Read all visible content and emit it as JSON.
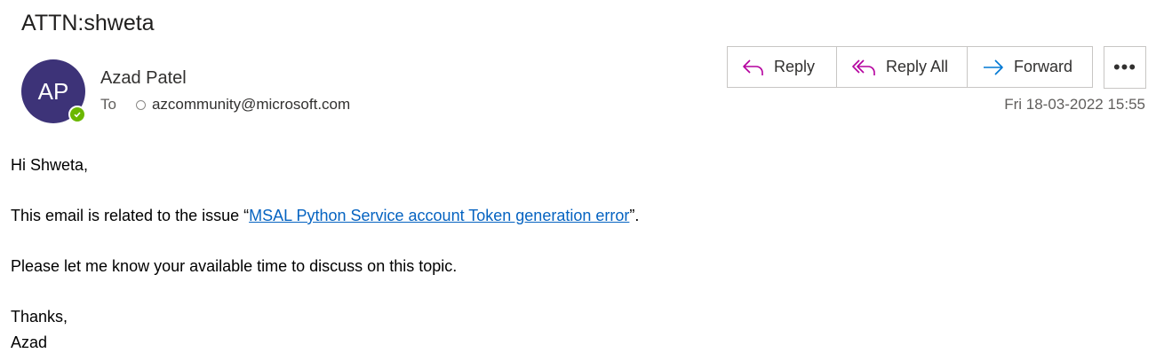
{
  "subject": "ATTN:shweta",
  "sender": {
    "initials": "AP",
    "name": "Azad Patel",
    "to_label": "To",
    "to_address": "azcommunity@microsoft.com",
    "presence_color": "#6bb700",
    "avatar_color": "#3d3378"
  },
  "actions": {
    "reply": "Reply",
    "reply_all": "Reply All",
    "forward": "Forward",
    "more": "•••"
  },
  "date": "Fri 18-03-2022 15:55",
  "body": {
    "greeting": "Hi Shweta,",
    "line1_prefix": "This email is related to the issue “",
    "line1_link": "MSAL Python Service account Token generation error",
    "line1_suffix": "”.",
    "line2": "Please let me know your available time to discuss on this topic.",
    "closing": "Thanks,",
    "signature": "Azad"
  },
  "colors": {
    "reply_icon": "#b4009e",
    "forward_icon": "#0078d4",
    "link": "#0563c1"
  }
}
